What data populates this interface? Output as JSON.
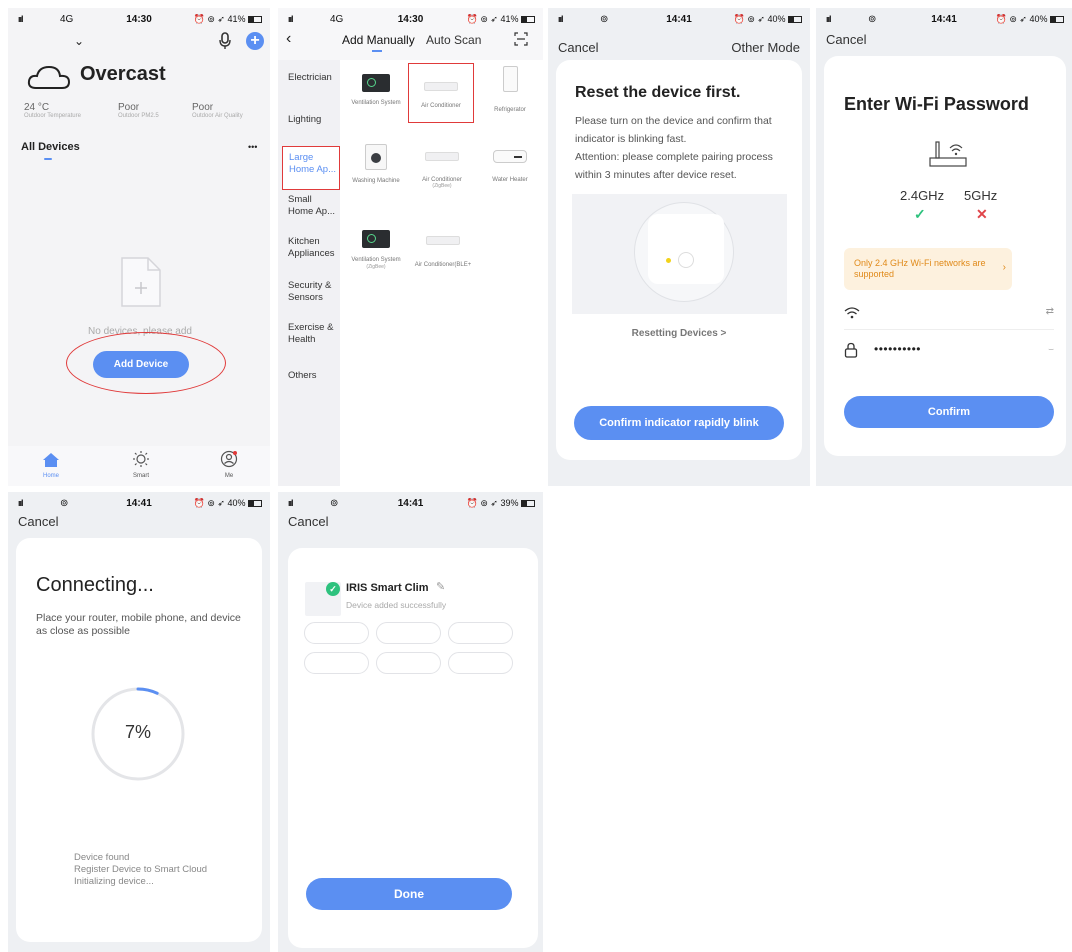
{
  "p1": {
    "status": {
      "signal": "ııl",
      "network": "4G",
      "time": "14:30",
      "battery": "41%"
    },
    "weather": "Overcast",
    "stats": [
      {
        "value": "24 °C",
        "label": "Outdoor Temperature"
      },
      {
        "value": "Poor",
        "label": "Outdoor PM2.5"
      },
      {
        "value": "Poor",
        "label": "Outdoor Air Quality"
      }
    ],
    "all_devices": "All Devices",
    "more": "•••",
    "empty_text": "No devices, please add",
    "add_device": "Add Device",
    "nav": [
      {
        "label": "Home"
      },
      {
        "label": "Smart"
      },
      {
        "label": "Me"
      }
    ],
    "annotation_color": "#e03a3a",
    "accent": "#5b8ff2"
  },
  "p2": {
    "status": {
      "signal": "ııl",
      "network": "4G",
      "time": "14:30",
      "battery": "41%"
    },
    "tabs": [
      "Add Manually",
      "Auto Scan"
    ],
    "categories": [
      "Electrician",
      "Lighting",
      "Large Home Ap...",
      "Small Home Ap...",
      "Kitchen Appliances",
      "Security & Sensors",
      "Exercise & Health",
      "Others"
    ],
    "devices": [
      {
        "label": "Ventilation System",
        "sub": ""
      },
      {
        "label": "Air Conditioner",
        "sub": ""
      },
      {
        "label": "Refrigerator",
        "sub": ""
      },
      {
        "label": "Washing Machine",
        "sub": ""
      },
      {
        "label": "Air Conditioner",
        "sub": "(ZigBee)"
      },
      {
        "label": "Water Heater",
        "sub": ""
      },
      {
        "label": "Ventilation System",
        "sub": "(ZigBee)"
      },
      {
        "label": "Air Conditioner(BLE+",
        "sub": ""
      }
    ]
  },
  "p3": {
    "status": {
      "signal": "ııl",
      "time": "14:41",
      "battery": "40%"
    },
    "cancel": "Cancel",
    "other_mode": "Other Mode",
    "title": "Reset the device first.",
    "body": "Please turn on the device and confirm that indicator is blinking fast.",
    "attention": "Attention: please complete pairing process within 3 minutes after device reset.",
    "resetting": "Resetting Devices >",
    "confirm": "Confirm indicator rapidly blink"
  },
  "p4": {
    "status": {
      "signal": "ııl",
      "time": "14:41",
      "battery": "40%"
    },
    "cancel": "Cancel",
    "title": "Enter Wi-Fi Password",
    "band1": "2.4GHz",
    "band2": "5GHz",
    "warning": "Only 2.4 GHz Wi-Fi networks are supported",
    "password": "••••••••••",
    "confirm": "Confirm"
  },
  "p5": {
    "status": {
      "signal": "ııl",
      "time": "14:41",
      "battery": "40%"
    },
    "cancel": "Cancel",
    "title": "Connecting...",
    "body": "Place your router, mobile phone, and device as close as possible",
    "progress": 7,
    "progress_label": "7%",
    "steps": [
      "Device found",
      "Register Device to Smart Cloud",
      "Initializing device..."
    ]
  },
  "p6": {
    "status": {
      "signal": "ııl",
      "time": "14:41",
      "battery": "39%"
    },
    "cancel": "Cancel",
    "device_name": "IRIS Smart Clim",
    "device_status": "Device added successfully",
    "done": "Done",
    "success_color": "#2ec27e"
  }
}
